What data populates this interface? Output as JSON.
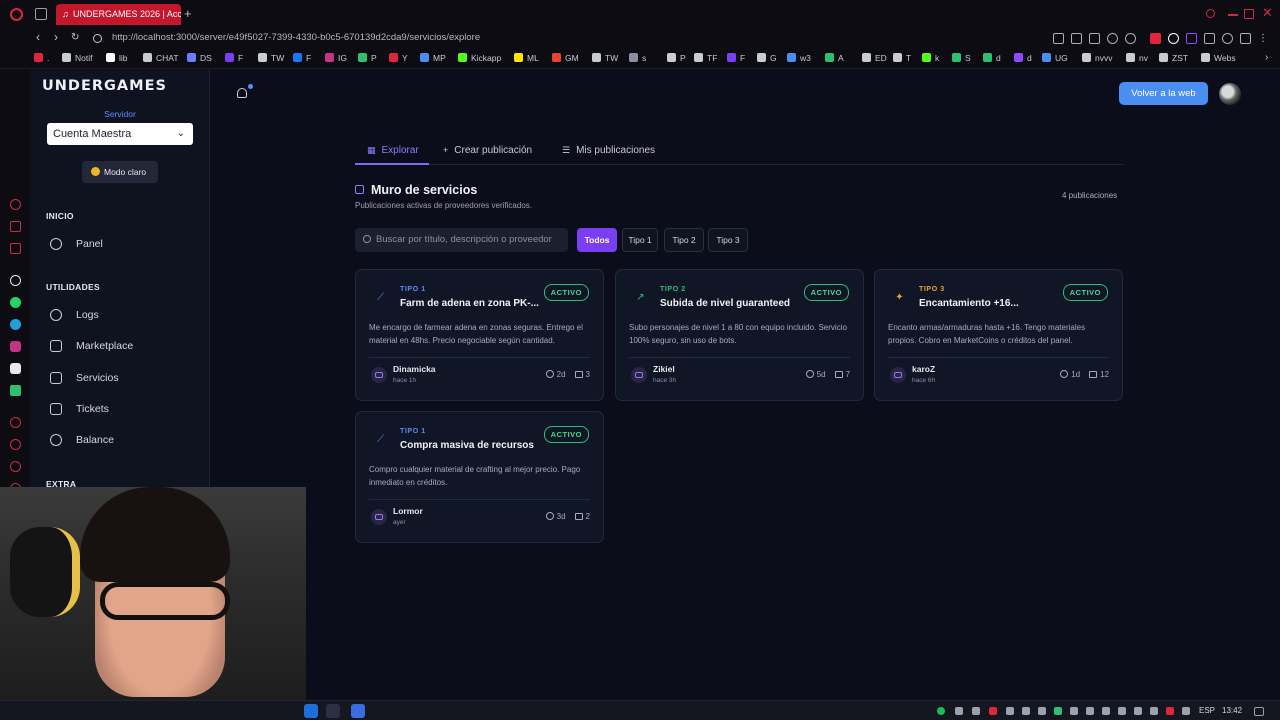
{
  "browser": {
    "active_tab_title": "UNDERGAMES 2026 | Acc",
    "new_tab_symbol": "+",
    "url": "http://localhost:3000/server/e49f5027-7399-4330-b0c5-670139d2cda9/servicios/explore",
    "bookmarks": [
      {
        "label": ".",
        "color": "#e0263d"
      },
      {
        "label": "Notif",
        "color": "#c7ccd6"
      },
      {
        "label": "lib",
        "color": "#ffffff"
      },
      {
        "label": "CHAT",
        "color": "#c7ccd6"
      },
      {
        "label": "DS",
        "color": "#6b7cff"
      },
      {
        "label": "F",
        "color": "#7a3ff2"
      },
      {
        "label": "TW",
        "color": "#c7ccd6"
      },
      {
        "label": "F",
        "color": "#1877f2"
      },
      {
        "label": "IG",
        "color": "#c13584"
      },
      {
        "label": "P",
        "color": "#2fbf71"
      },
      {
        "label": "Y",
        "color": "#e0263d"
      },
      {
        "label": "MP",
        "color": "#4a8ef2"
      },
      {
        "label": "Kickapp",
        "color": "#53fc18"
      },
      {
        "label": "ML",
        "color": "#ffe600"
      },
      {
        "label": "GM",
        "color": "#ea4335"
      },
      {
        "label": "TW",
        "color": "#c7ccd6"
      },
      {
        "label": "s",
        "color": "#8a90a3"
      },
      {
        "label": "P",
        "color": "#c7ccd6"
      },
      {
        "label": "TF",
        "color": "#c7ccd6"
      },
      {
        "label": "F",
        "color": "#7a3ff2"
      },
      {
        "label": "G",
        "color": "#c7ccd6"
      },
      {
        "label": "w3",
        "color": "#4a8ef2"
      },
      {
        "label": "A",
        "color": "#2fbf71"
      },
      {
        "label": "ED",
        "color": "#c7ccd6"
      },
      {
        "label": "T",
        "color": "#c7ccd6"
      },
      {
        "label": "k",
        "color": "#53fc18"
      },
      {
        "label": "S",
        "color": "#2fbf71"
      },
      {
        "label": "d",
        "color": "#2fbf71"
      },
      {
        "label": "d",
        "color": "#9146ff"
      },
      {
        "label": "UG",
        "color": "#4a8ef2"
      },
      {
        "label": "nvvv",
        "color": "#c7ccd6"
      },
      {
        "label": "nv",
        "color": "#c7ccd6"
      },
      {
        "label": "ZST",
        "color": "#c7ccd6"
      },
      {
        "label": "Webs",
        "color": "#c7ccd6"
      }
    ]
  },
  "sidebar": {
    "brand": "UNDERGAMES",
    "server_label": "Servidor",
    "server_value": "Cuenta Maestra",
    "mode_button": "Modo claro",
    "sections": [
      {
        "title": "INICIO",
        "items": [
          "Panel"
        ]
      },
      {
        "title": "UTILIDADES",
        "items": [
          "Logs",
          "Marketplace",
          "Servicios",
          "Tickets",
          "Balance"
        ]
      },
      {
        "title": "EXTRA",
        "items": []
      }
    ]
  },
  "header": {
    "web_button": "Volver a la web"
  },
  "tabs": [
    {
      "label": "Explorar",
      "icon": "grid-icon",
      "glyph": "▦"
    },
    {
      "label": "Crear publicación",
      "icon": "plus-icon",
      "glyph": "+"
    },
    {
      "label": "Mis publicaciones",
      "icon": "list-icon",
      "glyph": "☰"
    }
  ],
  "wall": {
    "title": "Muro de servicios",
    "subtitle": "Publicaciones activas de proveedores verificados.",
    "count": "4 publicaciones"
  },
  "search": {
    "placeholder": "Buscar por título, descripción o proveedor"
  },
  "filters": [
    "Todos",
    "Tipo 1",
    "Tipo 2",
    "Tipo 3"
  ],
  "cards": [
    {
      "type": "TIPO 1",
      "type_color": "#5b8cff",
      "icon": "link-icon",
      "icon_glyph": "⟋",
      "title": "Farm de adena en zona PK-...",
      "status": "ACTIVO",
      "description": "Me encargo de farmear adena en zonas seguras. Entrego el material en 48hs. Precio negociable según cantidad.",
      "user": "Dinamicka",
      "when": "hace 1h",
      "age": "2d",
      "comments": "3"
    },
    {
      "type": "TIPO 2",
      "type_color": "#2fbf71",
      "icon": "trending-up-icon",
      "icon_glyph": "↗",
      "title": "Subida de nivel guaranteed",
      "status": "ACTIVO",
      "description": "Subo personajes de nivel 1 a 80 con equipo incluido. Servicio 100% seguro, sin uso de bots.",
      "user": "Zikiel",
      "when": "hace 3h",
      "age": "5d",
      "comments": "7"
    },
    {
      "type": "TIPO 3",
      "type_color": "#f0a429",
      "icon": "sparkle-icon",
      "icon_glyph": "✦",
      "title": "Encantamiento +16...",
      "status": "ACTIVO",
      "description": "Encanto armas/armaduras hasta +16. Tengo materiales propios. Cobro en MarketCoins o créditos del panel.",
      "user": "karoZ",
      "when": "hace 6h",
      "age": "1d",
      "comments": "12"
    },
    {
      "type": "TIPO 1",
      "type_color": "#5b8cff",
      "icon": "link-icon",
      "icon_glyph": "⟋",
      "title": "Compra masiva de recursos",
      "status": "ACTIVO",
      "description": "Compro cualquier material de crafting al mejor precio. Pago inmediato en créditos.",
      "user": "Lormor",
      "when": "ayer",
      "age": "3d",
      "comments": "2"
    }
  ],
  "taskbar": {
    "lang": "ESP",
    "time": "13:42"
  }
}
